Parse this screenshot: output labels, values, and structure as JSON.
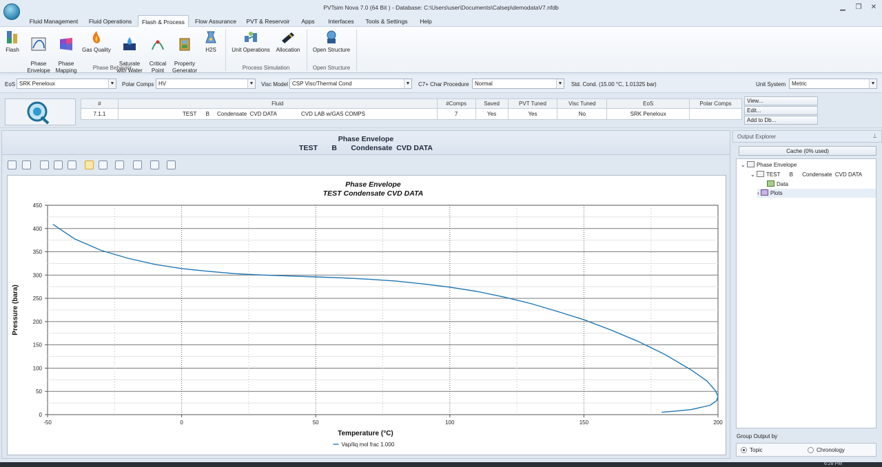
{
  "window": {
    "title": "PVTsim Nova 7.0 (64 Bit ) - Database: C:\\Users\\user\\Documents\\Calsep\\demodataV7.nfdb"
  },
  "menu": {
    "tabs": [
      "Fluid Management",
      "Fluid Operations",
      "Flash & Process",
      "Flow Assurance",
      "PVT & Reservoir",
      "Apps",
      "Interfaces",
      "Tools & Settings",
      "Help"
    ],
    "active": "Flash & Process"
  },
  "ribbon": {
    "phase_behavior": {
      "label": "Phase Behavior",
      "buttons": [
        {
          "label": "Flash",
          "icon": "flash-icon"
        },
        {
          "label": "Phase\nEnvelope",
          "icon": "phase-envelope-icon"
        },
        {
          "label": "Phase\nMapping",
          "icon": "phase-mapping-icon"
        },
        {
          "label": "Gas Quality",
          "icon": "gas-quality-icon"
        },
        {
          "label": "Saturate\nwith Water",
          "icon": "saturate-water-icon"
        },
        {
          "label": "Critical\nPoint",
          "icon": "critical-point-icon"
        },
        {
          "label": "Property\nGenerator",
          "icon": "property-generator-icon"
        },
        {
          "label": "H2S",
          "icon": "h2s-icon"
        }
      ]
    },
    "process_simulation": {
      "label": "Process Simulation",
      "buttons": [
        {
          "label": "Unit Operations",
          "icon": "unit-operations-icon"
        },
        {
          "label": "Allocation",
          "icon": "allocation-icon"
        }
      ]
    },
    "open_structure": {
      "label": "Open Structure",
      "buttons": [
        {
          "label": "Open Structure",
          "icon": "open-structure-icon"
        }
      ]
    }
  },
  "settings": {
    "eos_label": "EoS",
    "eos_value": "SRK Peneloux",
    "polar_label": "Polar Comps",
    "polar_value": "HV",
    "visc_label": "Visc Model",
    "visc_value": "CSP Visc/Thermal Cond",
    "c7_label": "C7+ Char Procedure",
    "c7_value": "Normal",
    "std_cond": "Std. Cond. (15.00 °C, 1.01325 bar)",
    "unit_label": "Unit System",
    "unit_value": "Metric"
  },
  "fluid_table": {
    "headers": [
      "#",
      "Fluid",
      "#Comps",
      "Saved",
      "PVT Tuned",
      "Visc Tuned",
      "EoS",
      "Polar Comps"
    ],
    "row": {
      "num": "7.1.1",
      "fluid_a": "TEST",
      "fluid_b": "B",
      "fluid_c": "Condensate  CVD DATA",
      "fluid_d": "CVD LAB w/GAS COMPS",
      "comps": "7",
      "saved": "Yes",
      "pvt_tuned": "Yes",
      "visc_tuned": "No",
      "eos": "SRK Peneloux",
      "polar": ""
    }
  },
  "side_buttons": [
    "View...",
    "Edit...",
    "Add to Db..."
  ],
  "panel": {
    "title": "Phase Envelope",
    "subtitle_a": "TEST",
    "subtitle_b": "B",
    "subtitle_c": "Condensate  CVD DATA"
  },
  "chart_data": {
    "type": "line",
    "title": "Phase Envelope",
    "subtitle": "TEST Condensate CVD DATA",
    "xlabel": "Temperature (°C)",
    "ylabel": "Pressure (bara)",
    "xlim": [
      -50,
      200
    ],
    "ylim": [
      0,
      450
    ],
    "xticks": [
      -50,
      0,
      50,
      100,
      150,
      200
    ],
    "yticks": [
      0,
      50,
      100,
      150,
      200,
      250,
      300,
      350,
      400,
      450
    ],
    "grid": true,
    "legend_position": "bottom",
    "series": [
      {
        "name": "Vap/liq mol frac 1.000",
        "color": "#1f77b4",
        "x": [
          -48,
          -40,
          -30,
          -20,
          -10,
          0,
          10,
          20,
          30,
          40,
          50,
          60,
          70,
          80,
          90,
          100,
          110,
          120,
          130,
          140,
          150,
          160,
          170,
          180,
          190,
          196,
          199,
          200,
          199.5,
          197,
          190,
          185,
          179
        ],
        "y": [
          409,
          378,
          353,
          336,
          323,
          314,
          308,
          303,
          300,
          298,
          296,
          294,
          291,
          287,
          281,
          274,
          265,
          253,
          239,
          222,
          204,
          182,
          158,
          130,
          96,
          72,
          52,
          40,
          30,
          20,
          11,
          8,
          5
        ]
      }
    ]
  },
  "explorer": {
    "title": "Output Explorer",
    "cache": "Cache (0% used)",
    "tree": {
      "root": "Phase Envelope",
      "child_a": "TEST",
      "child_b": "B",
      "child_c": "Condensate  CVD DATA",
      "data": "Data",
      "plots": "Plots"
    },
    "group_label": "Group Output by",
    "group_options": [
      "Topic",
      "Chronology"
    ],
    "group_selected": "Topic"
  },
  "status": {
    "time": "6:28 PM"
  }
}
